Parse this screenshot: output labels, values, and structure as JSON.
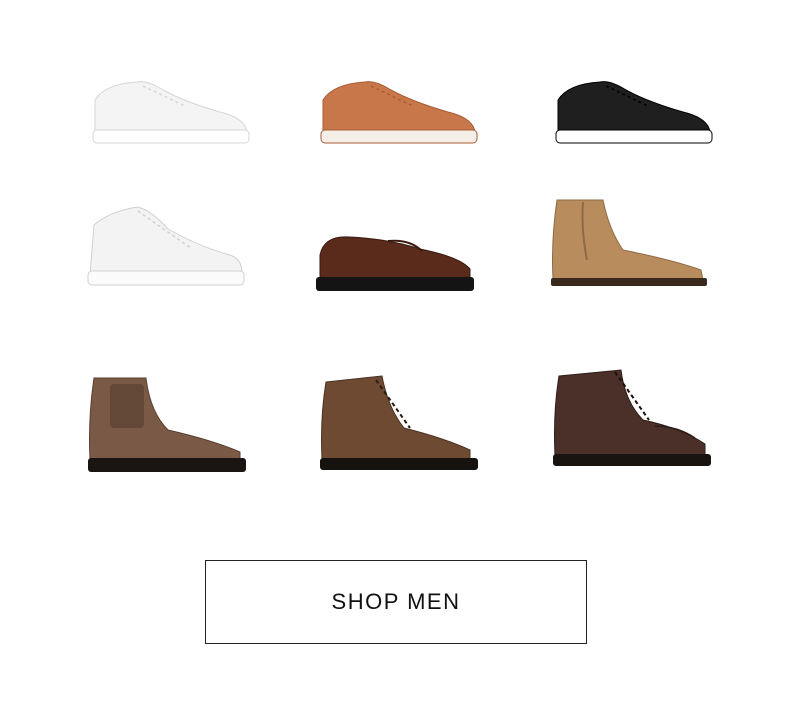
{
  "products": [
    {
      "name": "white-low-sneaker-image",
      "style": "low-sneaker",
      "upper": "#f4f4f4",
      "sole": "#ffffff",
      "outline": "#d6d6d6"
    },
    {
      "name": "tan-low-sneaker-image",
      "style": "low-sneaker",
      "upper": "#c8774a",
      "sole": "#f3efe6",
      "outline": "#a85e36"
    },
    {
      "name": "black-low-sneaker-image",
      "style": "low-sneaker",
      "upper": "#1f1f1f",
      "sole": "#ffffff",
      "outline": "#000000"
    },
    {
      "name": "white-high-sneaker-image",
      "style": "high-sneaker",
      "upper": "#f3f3f3",
      "sole": "#fbfbfb",
      "outline": "#d0d0d0"
    },
    {
      "name": "brown-loafer-image",
      "style": "loafer",
      "upper": "#5a2a1a",
      "sole": "#141414",
      "outline": "#3a1a10"
    },
    {
      "name": "tan-suede-chelsea-boot-image",
      "style": "chelsea",
      "upper": "#b88c5d",
      "sole": "#3a2a1e",
      "outline": "#8e6a44"
    },
    {
      "name": "brown-chelsea-boot-image",
      "style": "chelsea-lug",
      "upper": "#7a5a46",
      "sole": "#1a1512",
      "outline": "#5a3f30"
    },
    {
      "name": "brown-lace-up-boot-image",
      "style": "lace-boot",
      "upper": "#6e4a33",
      "sole": "#161210",
      "outline": "#4c3222"
    },
    {
      "name": "dark-brown-moc-toe-boot-image",
      "style": "moc-boot",
      "upper": "#4a3028",
      "sole": "#1a1410",
      "outline": "#2e1d17"
    }
  ],
  "cta": {
    "label": "SHOP MEN"
  }
}
